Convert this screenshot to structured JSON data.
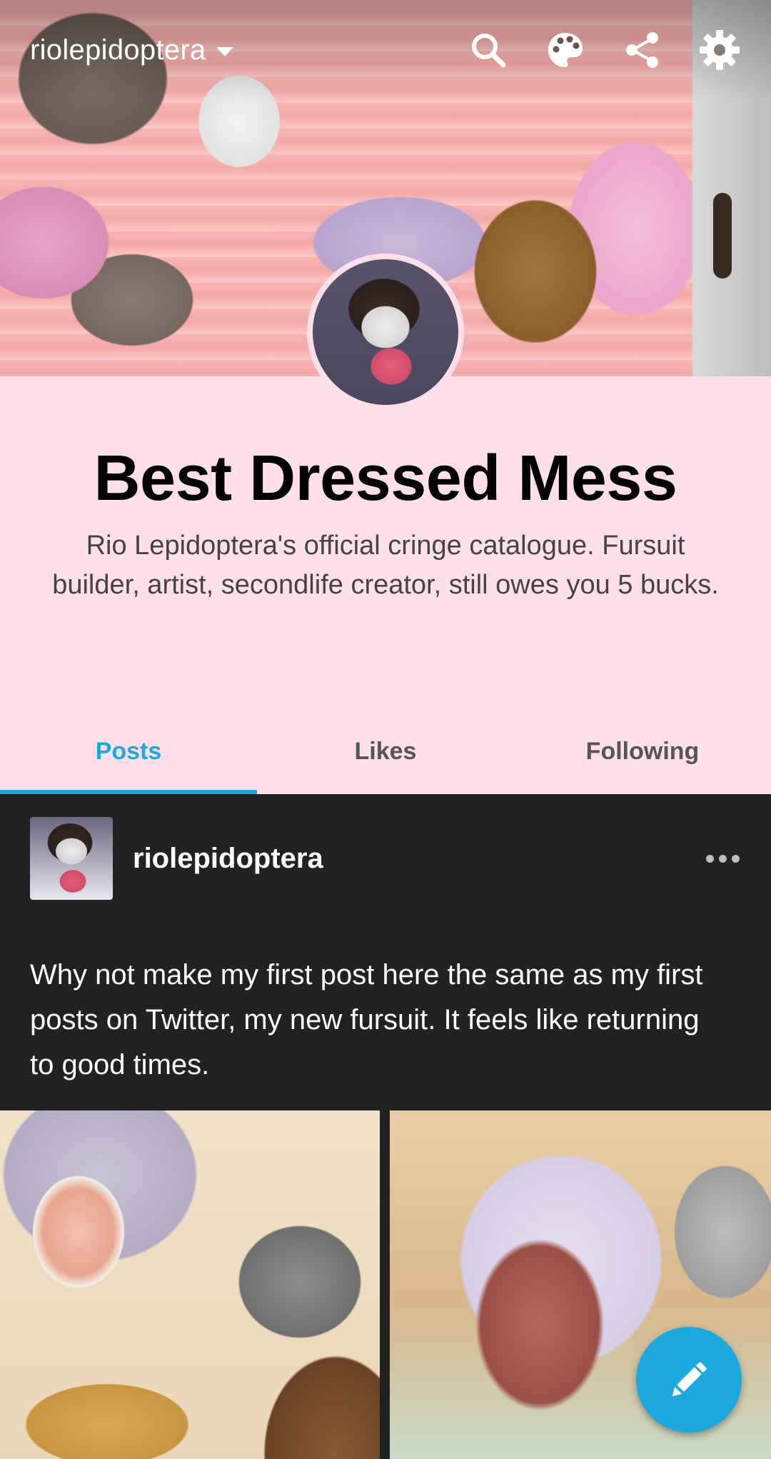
{
  "header": {
    "blog_name": "riolepidoptera",
    "icons": [
      "search-icon",
      "palette-icon",
      "share-icon",
      "settings-icon"
    ]
  },
  "profile": {
    "title": "Best Dressed Mess",
    "description": "Rio Lepidoptera's official cringe catalogue. Fursuit builder, artist, secondlife creator, still owes you 5 bucks."
  },
  "tabs": [
    {
      "label": "Posts",
      "active": true
    },
    {
      "label": "Likes",
      "active": false
    },
    {
      "label": "Following",
      "active": false
    }
  ],
  "post": {
    "username": "riolepidoptera",
    "text": "Why not make my first post here the same as my first posts on Twitter, my new fursuit. It feels like returning to good times."
  },
  "fab": {
    "icon": "compose-pencil-icon"
  },
  "colors": {
    "accent": "#1da8e0",
    "profile_background": "#ffe0ea",
    "post_background": "#222222"
  }
}
